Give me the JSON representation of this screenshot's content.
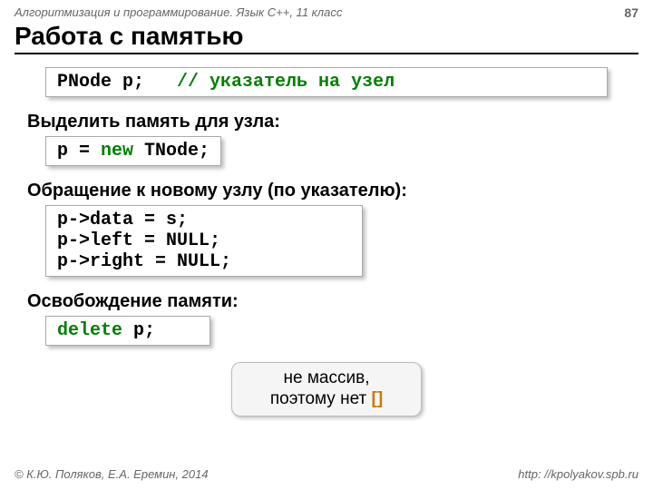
{
  "header": {
    "course": "Алгоритмизация и программирование. Язык C++, 11 класс",
    "page": "87"
  },
  "title": "Работа с памятью",
  "code1": {
    "decl": "PNode p;",
    "comment": "// указатель на узел"
  },
  "section1": "Выделить память для узла:",
  "code2_a": "p",
  "code2_b": " = ",
  "code2_c": "new",
  "code2_d": " TNode;",
  "section2": "Обращение к новому узлу (по указателю):",
  "code3_l1a": "p->data",
  "code3_l1b": " = ",
  "code3_l1c": "s;               ",
  "code3_l2a": "p->left",
  "code3_l2b": " = ",
  "code3_l2c": "NULL;",
  "code3_l3a": "p->right",
  "code3_l3b": " = ",
  "code3_l3c": "NULL;",
  "section3": "Освобождение памяти:",
  "code4_a": "delete",
  "code4_b": " p;    ",
  "callout": {
    "line1": "не массив,",
    "line2a": "поэтому нет ",
    "line2b": "[]"
  },
  "footer": {
    "copyright": "© К.Ю. Поляков, Е.А. Еремин, 2014",
    "url": "http: //kpolyakov.spb.ru"
  }
}
